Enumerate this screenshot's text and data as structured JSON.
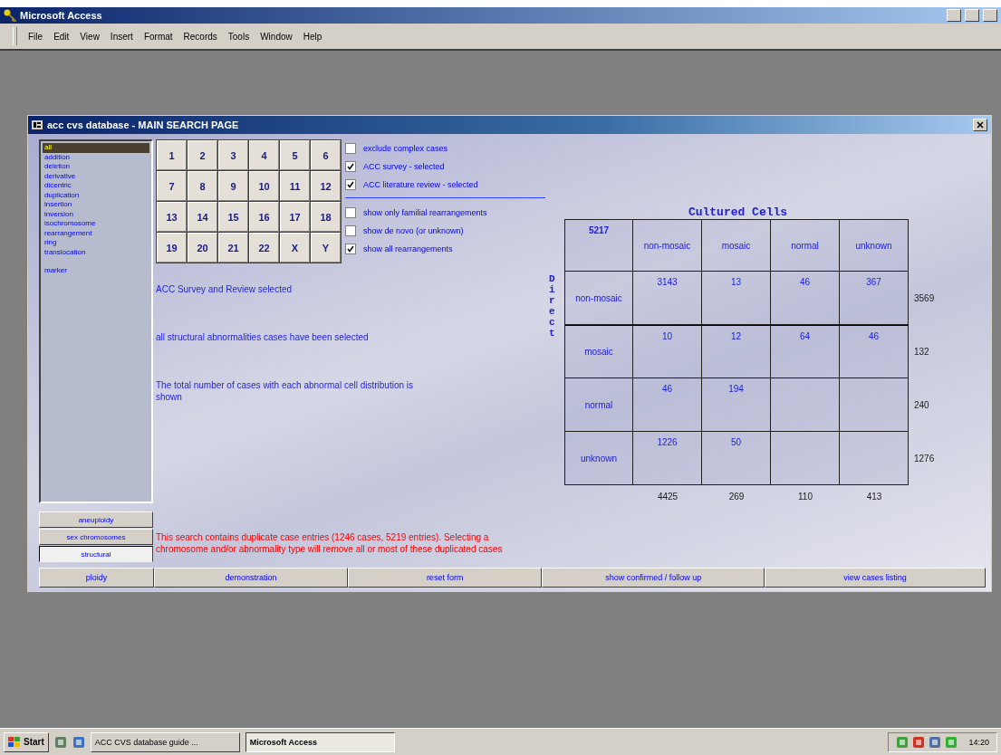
{
  "app_window": {
    "title": "Microsoft Access"
  },
  "menu": [
    "File",
    "Edit",
    "View",
    "Insert",
    "Format",
    "Records",
    "Tools",
    "Window",
    "Help"
  ],
  "form": {
    "title": "acc cvs database - MAIN SEARCH PAGE",
    "abnormality_types": [
      [
        {
          "label": "all",
          "selected": true
        },
        {
          "label": "addition",
          "selected": false
        },
        {
          "label": "deletion",
          "selected": false
        },
        {
          "label": "derivative",
          "selected": false
        },
        {
          "label": "dicentric",
          "selected": false
        },
        {
          "label": "duplication",
          "selected": false
        },
        {
          "label": "insertion",
          "selected": false
        },
        {
          "label": "inversion",
          "selected": false
        },
        {
          "label": "isochromosome",
          "selected": false
        },
        {
          "label": "rearrangement",
          "selected": false
        },
        {
          "label": "ring",
          "selected": false
        },
        {
          "label": "translocation",
          "selected": false
        }
      ],
      [
        {
          "label": "marker",
          "selected": false
        }
      ]
    ],
    "category_tabs": [
      {
        "label": "aneuploidy",
        "selected": false
      },
      {
        "label": "sex chromosomes",
        "selected": false
      },
      {
        "label": "structural",
        "selected": true
      }
    ],
    "chromosomes": [
      "1",
      "2",
      "3",
      "4",
      "5",
      "6",
      "7",
      "8",
      "9",
      "10",
      "11",
      "12",
      "13",
      "14",
      "15",
      "16",
      "17",
      "18",
      "19",
      "20",
      "21",
      "22",
      "X",
      "Y"
    ],
    "option_groups": [
      [
        {
          "label": "exclude complex cases",
          "checked": false
        },
        {
          "label": "ACC survey - selected",
          "checked": true
        },
        {
          "label": "ACC literature review - selected",
          "checked": true
        }
      ],
      [
        {
          "label": "show only familial rearrangements",
          "checked": false
        },
        {
          "label": "show de novo (or unknown)",
          "checked": false
        },
        {
          "label": "show all rearrangements",
          "checked": true
        }
      ]
    ],
    "messages": [
      {
        "text": "ACC Survey and Review selected",
        "kind": "info"
      },
      {
        "text": "all structural abnormalities cases have been selected",
        "kind": "info"
      },
      {
        "text": "The total number of cases with each abnormal cell distribution is shown",
        "kind": "info"
      },
      {
        "text": "This search contains duplicate case entries (1246 cases, 5219 entries). Selecting a chromosome and/or abnormality type will remove all or most of these duplicated cases",
        "kind": "warning"
      }
    ],
    "table": {
      "title": "Cultured Cells",
      "side_label": "Direct",
      "corner": "5217",
      "columns": [
        "non-mosaic",
        "mosaic",
        "normal",
        "unknown"
      ],
      "rows": [
        {
          "label": "non-mosaic",
          "cells": [
            "3143",
            "13",
            "46",
            "367"
          ],
          "total": "3569"
        },
        {
          "label": "mosaic",
          "cells": [
            "10",
            "12",
            "64",
            "46"
          ],
          "total": "132"
        },
        {
          "label": "normal",
          "cells": [
            "46",
            "194",
            null,
            null
          ],
          "total": "240"
        },
        {
          "label": "unknown",
          "cells": [
            "1226",
            "50",
            null,
            null
          ],
          "total": "1276"
        }
      ],
      "column_totals": [
        "4425",
        "269",
        "110",
        "413"
      ]
    },
    "side_button": "ploidy",
    "buttons": [
      "demonstration",
      "reset form",
      "show confirmed / follow up",
      "view cases listing"
    ]
  },
  "taskbar": {
    "start": "Start",
    "tasks": [
      {
        "label": "ACC CVS database guide ...",
        "selected": false
      },
      {
        "label": "Microsoft Access",
        "selected": true
      }
    ],
    "clock": "14:20"
  }
}
